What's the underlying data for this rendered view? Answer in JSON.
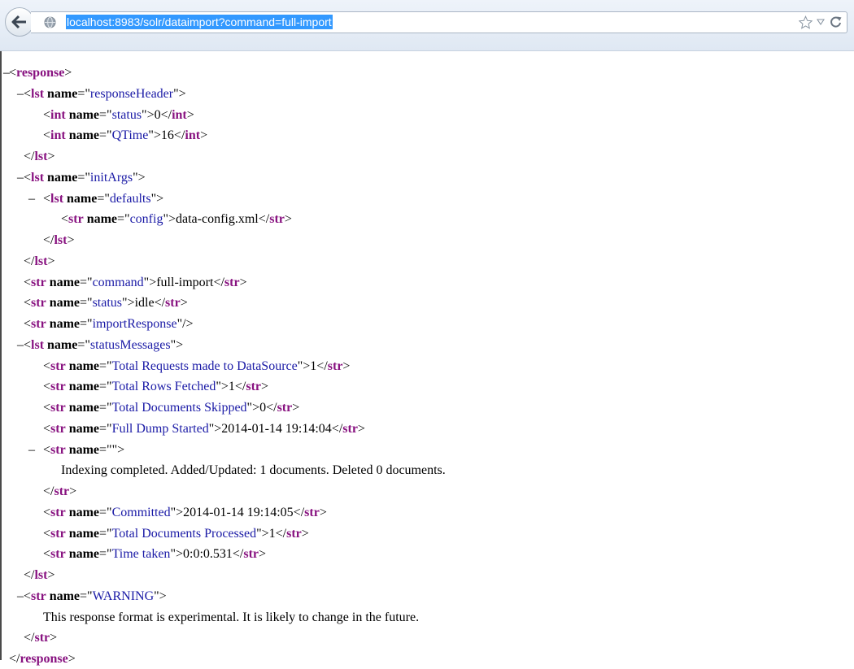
{
  "browser": {
    "url": "localhost:8983/solr/dataimport?command=full-import",
    "icons": {
      "back": "back-arrow-icon",
      "site": "globe-icon",
      "bookmark": "star-icon",
      "dropdown": "dropdown-arrow-icon",
      "reload": "reload-icon"
    }
  },
  "xml": {
    "toggle": "–",
    "lines": [
      {
        "indent": 0,
        "toggle": true,
        "parts": [
          [
            "p",
            "<"
          ],
          [
            "t",
            "response"
          ],
          [
            "p",
            ">"
          ]
        ]
      },
      {
        "indent": 1,
        "toggle": true,
        "parts": [
          [
            "p",
            "<"
          ],
          [
            "t",
            "lst"
          ],
          [
            "p",
            " "
          ],
          [
            "a",
            "name"
          ],
          [
            "p",
            "=\""
          ],
          [
            "v",
            "responseHeader"
          ],
          [
            "p",
            "\">"
          ]
        ]
      },
      {
        "indent": 2,
        "toggle": false,
        "parts": [
          [
            "p",
            "<"
          ],
          [
            "t",
            "int"
          ],
          [
            "p",
            " "
          ],
          [
            "a",
            "name"
          ],
          [
            "p",
            "=\""
          ],
          [
            "v",
            "status"
          ],
          [
            "p",
            "\">0</"
          ],
          [
            "t",
            "int"
          ],
          [
            "p",
            ">"
          ]
        ]
      },
      {
        "indent": 2,
        "toggle": false,
        "parts": [
          [
            "p",
            "<"
          ],
          [
            "t",
            "int"
          ],
          [
            "p",
            " "
          ],
          [
            "a",
            "name"
          ],
          [
            "p",
            "=\""
          ],
          [
            "v",
            "QTime"
          ],
          [
            "p",
            "\">16</"
          ],
          [
            "t",
            "int"
          ],
          [
            "p",
            ">"
          ]
        ]
      },
      {
        "indent": 1,
        "toggle": false,
        "parts": [
          [
            "p",
            "</"
          ],
          [
            "t",
            "lst"
          ],
          [
            "p",
            ">"
          ]
        ]
      },
      {
        "indent": 1,
        "toggle": true,
        "parts": [
          [
            "p",
            "<"
          ],
          [
            "t",
            "lst"
          ],
          [
            "p",
            " "
          ],
          [
            "a",
            "name"
          ],
          [
            "p",
            "=\""
          ],
          [
            "v",
            "initArgs"
          ],
          [
            "p",
            "\">"
          ]
        ]
      },
      {
        "indent": 2,
        "toggle": true,
        "parts": [
          [
            "p",
            "<"
          ],
          [
            "t",
            "lst"
          ],
          [
            "p",
            " "
          ],
          [
            "a",
            "name"
          ],
          [
            "p",
            "=\""
          ],
          [
            "v",
            "defaults"
          ],
          [
            "p",
            "\">"
          ]
        ]
      },
      {
        "indent": 3,
        "toggle": false,
        "parts": [
          [
            "p",
            "<"
          ],
          [
            "t",
            "str"
          ],
          [
            "p",
            " "
          ],
          [
            "a",
            "name"
          ],
          [
            "p",
            "=\""
          ],
          [
            "v",
            "config"
          ],
          [
            "p",
            "\">data-config.xml</"
          ],
          [
            "t",
            "str"
          ],
          [
            "p",
            ">"
          ]
        ]
      },
      {
        "indent": 2,
        "toggle": false,
        "parts": [
          [
            "p",
            "</"
          ],
          [
            "t",
            "lst"
          ],
          [
            "p",
            ">"
          ]
        ]
      },
      {
        "indent": 1,
        "toggle": false,
        "parts": [
          [
            "p",
            "</"
          ],
          [
            "t",
            "lst"
          ],
          [
            "p",
            ">"
          ]
        ]
      },
      {
        "indent": 1,
        "toggle": false,
        "parts": [
          [
            "p",
            "<"
          ],
          [
            "t",
            "str"
          ],
          [
            "p",
            " "
          ],
          [
            "a",
            "name"
          ],
          [
            "p",
            "=\""
          ],
          [
            "v",
            "command"
          ],
          [
            "p",
            "\">full-import</"
          ],
          [
            "t",
            "str"
          ],
          [
            "p",
            ">"
          ]
        ]
      },
      {
        "indent": 1,
        "toggle": false,
        "parts": [
          [
            "p",
            "<"
          ],
          [
            "t",
            "str"
          ],
          [
            "p",
            " "
          ],
          [
            "a",
            "name"
          ],
          [
            "p",
            "=\""
          ],
          [
            "v",
            "status"
          ],
          [
            "p",
            "\">idle</"
          ],
          [
            "t",
            "str"
          ],
          [
            "p",
            ">"
          ]
        ]
      },
      {
        "indent": 1,
        "toggle": false,
        "parts": [
          [
            "p",
            "<"
          ],
          [
            "t",
            "str"
          ],
          [
            "p",
            " "
          ],
          [
            "a",
            "name"
          ],
          [
            "p",
            "=\""
          ],
          [
            "v",
            "importResponse"
          ],
          [
            "p",
            "\"/>"
          ]
        ]
      },
      {
        "indent": 1,
        "toggle": true,
        "parts": [
          [
            "p",
            "<"
          ],
          [
            "t",
            "lst"
          ],
          [
            "p",
            " "
          ],
          [
            "a",
            "name"
          ],
          [
            "p",
            "=\""
          ],
          [
            "v",
            "statusMessages"
          ],
          [
            "p",
            "\">"
          ]
        ]
      },
      {
        "indent": 2,
        "toggle": false,
        "parts": [
          [
            "p",
            "<"
          ],
          [
            "t",
            "str"
          ],
          [
            "p",
            " "
          ],
          [
            "a",
            "name"
          ],
          [
            "p",
            "=\""
          ],
          [
            "v",
            "Total Requests made to DataSource"
          ],
          [
            "p",
            "\">1</"
          ],
          [
            "t",
            "str"
          ],
          [
            "p",
            ">"
          ]
        ]
      },
      {
        "indent": 2,
        "toggle": false,
        "parts": [
          [
            "p",
            "<"
          ],
          [
            "t",
            "str"
          ],
          [
            "p",
            " "
          ],
          [
            "a",
            "name"
          ],
          [
            "p",
            "=\""
          ],
          [
            "v",
            "Total Rows Fetched"
          ],
          [
            "p",
            "\">1</"
          ],
          [
            "t",
            "str"
          ],
          [
            "p",
            ">"
          ]
        ]
      },
      {
        "indent": 2,
        "toggle": false,
        "parts": [
          [
            "p",
            "<"
          ],
          [
            "t",
            "str"
          ],
          [
            "p",
            " "
          ],
          [
            "a",
            "name"
          ],
          [
            "p",
            "=\""
          ],
          [
            "v",
            "Total Documents Skipped"
          ],
          [
            "p",
            "\">0</"
          ],
          [
            "t",
            "str"
          ],
          [
            "p",
            ">"
          ]
        ]
      },
      {
        "indent": 2,
        "toggle": false,
        "parts": [
          [
            "p",
            "<"
          ],
          [
            "t",
            "str"
          ],
          [
            "p",
            " "
          ],
          [
            "a",
            "name"
          ],
          [
            "p",
            "=\""
          ],
          [
            "v",
            "Full Dump Started"
          ],
          [
            "p",
            "\">2014-01-14 19:14:04</"
          ],
          [
            "t",
            "str"
          ],
          [
            "p",
            ">"
          ]
        ]
      },
      {
        "indent": 2,
        "toggle": true,
        "parts": [
          [
            "p",
            "<"
          ],
          [
            "t",
            "str"
          ],
          [
            "p",
            " "
          ],
          [
            "a",
            "name"
          ],
          [
            "p",
            "=\"\">"
          ]
        ]
      },
      {
        "indent": 3,
        "toggle": false,
        "parts": [
          [
            "p",
            "Indexing completed. Added/Updated: 1 documents. Deleted 0 documents."
          ]
        ]
      },
      {
        "indent": 2,
        "toggle": false,
        "parts": [
          [
            "p",
            "</"
          ],
          [
            "t",
            "str"
          ],
          [
            "p",
            ">"
          ]
        ]
      },
      {
        "indent": 2,
        "toggle": false,
        "parts": [
          [
            "p",
            "<"
          ],
          [
            "t",
            "str"
          ],
          [
            "p",
            " "
          ],
          [
            "a",
            "name"
          ],
          [
            "p",
            "=\""
          ],
          [
            "v",
            "Committed"
          ],
          [
            "p",
            "\">2014-01-14 19:14:05</"
          ],
          [
            "t",
            "str"
          ],
          [
            "p",
            ">"
          ]
        ]
      },
      {
        "indent": 2,
        "toggle": false,
        "parts": [
          [
            "p",
            "<"
          ],
          [
            "t",
            "str"
          ],
          [
            "p",
            " "
          ],
          [
            "a",
            "name"
          ],
          [
            "p",
            "=\""
          ],
          [
            "v",
            "Total Documents Processed"
          ],
          [
            "p",
            "\">1</"
          ],
          [
            "t",
            "str"
          ],
          [
            "p",
            ">"
          ]
        ]
      },
      {
        "indent": 2,
        "toggle": false,
        "parts": [
          [
            "p",
            "<"
          ],
          [
            "t",
            "str"
          ],
          [
            "p",
            " "
          ],
          [
            "a",
            "name"
          ],
          [
            "p",
            "=\""
          ],
          [
            "v",
            "Time taken"
          ],
          [
            "p",
            "\">0:0:0.531</"
          ],
          [
            "t",
            "str"
          ],
          [
            "p",
            ">"
          ]
        ]
      },
      {
        "indent": 1,
        "toggle": false,
        "parts": [
          [
            "p",
            "</"
          ],
          [
            "t",
            "lst"
          ],
          [
            "p",
            ">"
          ]
        ]
      },
      {
        "indent": 1,
        "toggle": true,
        "parts": [
          [
            "p",
            "<"
          ],
          [
            "t",
            "str"
          ],
          [
            "p",
            " "
          ],
          [
            "a",
            "name"
          ],
          [
            "p",
            "=\""
          ],
          [
            "v",
            "WARNING"
          ],
          [
            "p",
            "\">"
          ]
        ]
      },
      {
        "indent": 2,
        "toggle": false,
        "parts": [
          [
            "p",
            "This response format is experimental. It is likely to change in the future."
          ]
        ]
      },
      {
        "indent": 1,
        "toggle": false,
        "parts": [
          [
            "p",
            "</"
          ],
          [
            "t",
            "str"
          ],
          [
            "p",
            ">"
          ]
        ]
      },
      {
        "indent": 0,
        "toggle": false,
        "parts": [
          [
            "p",
            "</"
          ],
          [
            "t",
            "response"
          ],
          [
            "p",
            ">"
          ]
        ]
      }
    ]
  }
}
